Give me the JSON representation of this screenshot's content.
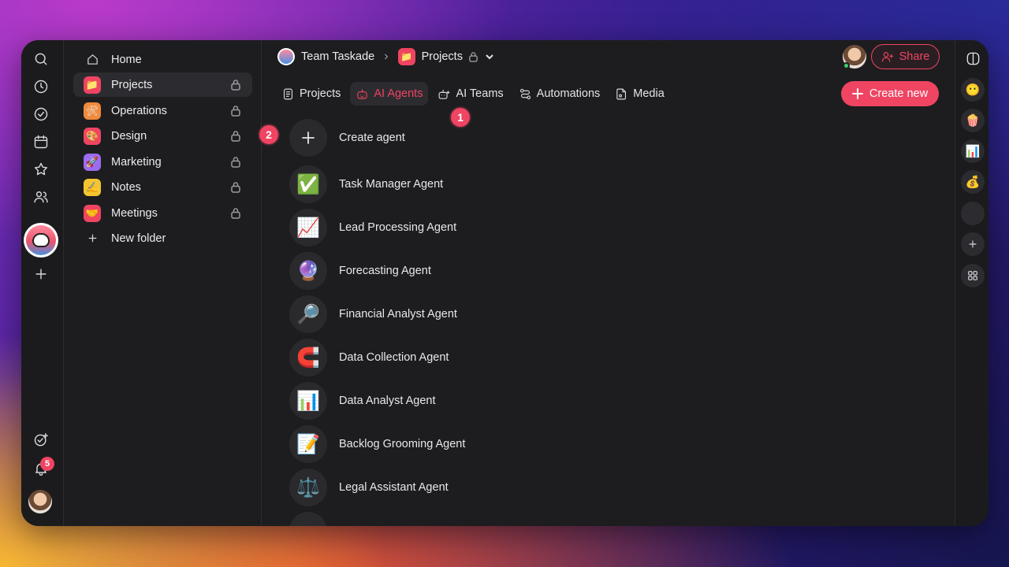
{
  "breadcrumb": {
    "workspace": "Team Taskade",
    "project": "Projects"
  },
  "header": {
    "share_label": "Share",
    "create_new_label": "Create new"
  },
  "tabs": [
    {
      "label": "Projects",
      "icon": "document-icon",
      "active": false
    },
    {
      "label": "AI Agents",
      "icon": "robot-icon",
      "active": true
    },
    {
      "label": "AI Teams",
      "icon": "robot-team-icon",
      "active": false
    },
    {
      "label": "Automations",
      "icon": "automation-icon",
      "active": false
    },
    {
      "label": "Media",
      "icon": "media-icon",
      "active": false
    }
  ],
  "sidebar": {
    "items": [
      {
        "label": "Home",
        "icon": "home-icon",
        "emoji": "",
        "color": "",
        "locked": false
      },
      {
        "label": "Projects",
        "icon": "folder-icon",
        "emoji": "📁",
        "color": "#ef4462",
        "locked": true,
        "active": true
      },
      {
        "label": "Operations",
        "icon": "tools-icon",
        "emoji": "🛠",
        "color": "#f08a3c",
        "locked": true
      },
      {
        "label": "Design",
        "icon": "palette-icon",
        "emoji": "🎨",
        "color": "#ef4462",
        "locked": true
      },
      {
        "label": "Marketing",
        "icon": "rocket-icon",
        "emoji": "🚀",
        "color": "#9b6cf0",
        "locked": true
      },
      {
        "label": "Notes",
        "icon": "pencil-icon",
        "emoji": "✍",
        "color": "#f5c530",
        "locked": true
      },
      {
        "label": "Meetings",
        "icon": "handshake-icon",
        "emoji": "🤝",
        "color": "#ef4462",
        "locked": true
      }
    ],
    "new_folder_label": "New folder"
  },
  "agents": [
    {
      "label": "Create agent",
      "emoji": "",
      "icon": "plus-icon"
    },
    {
      "label": "Task Manager Agent",
      "emoji": "✅",
      "icon": "check-box-icon"
    },
    {
      "label": "Lead Processing Agent",
      "emoji": "📈",
      "icon": "chart-up-icon"
    },
    {
      "label": "Forecasting Agent",
      "emoji": "🔮",
      "icon": "crystal-ball-icon"
    },
    {
      "label": "Financial Analyst Agent",
      "emoji": "🔎",
      "icon": "magnifier-icon"
    },
    {
      "label": "Data Collection Agent",
      "emoji": "🧲",
      "icon": "magnet-icon"
    },
    {
      "label": "Data Analyst Agent",
      "emoji": "📊",
      "icon": "bar-chart-icon"
    },
    {
      "label": "Backlog Grooming Agent",
      "emoji": "📝",
      "icon": "memo-icon"
    },
    {
      "label": "Legal Assistant Agent",
      "emoji": "⚖️",
      "icon": "scales-icon"
    }
  ],
  "callouts": {
    "one": "1",
    "two": "2"
  },
  "notifications": {
    "count": "5"
  },
  "right_rail": {
    "items": [
      {
        "icon": "workspace-icon",
        "emoji": "😶"
      },
      {
        "icon": "popcorn-icon",
        "emoji": "🍿"
      },
      {
        "icon": "bar-chart-icon",
        "emoji": "📊"
      },
      {
        "icon": "money-bag-icon",
        "emoji": "💰"
      },
      {
        "icon": "blank-icon",
        "emoji": ""
      }
    ]
  },
  "colors": {
    "accent": "#ef4462",
    "window_bg": "#1d1d1f",
    "active_bg": "#2c2c30"
  }
}
